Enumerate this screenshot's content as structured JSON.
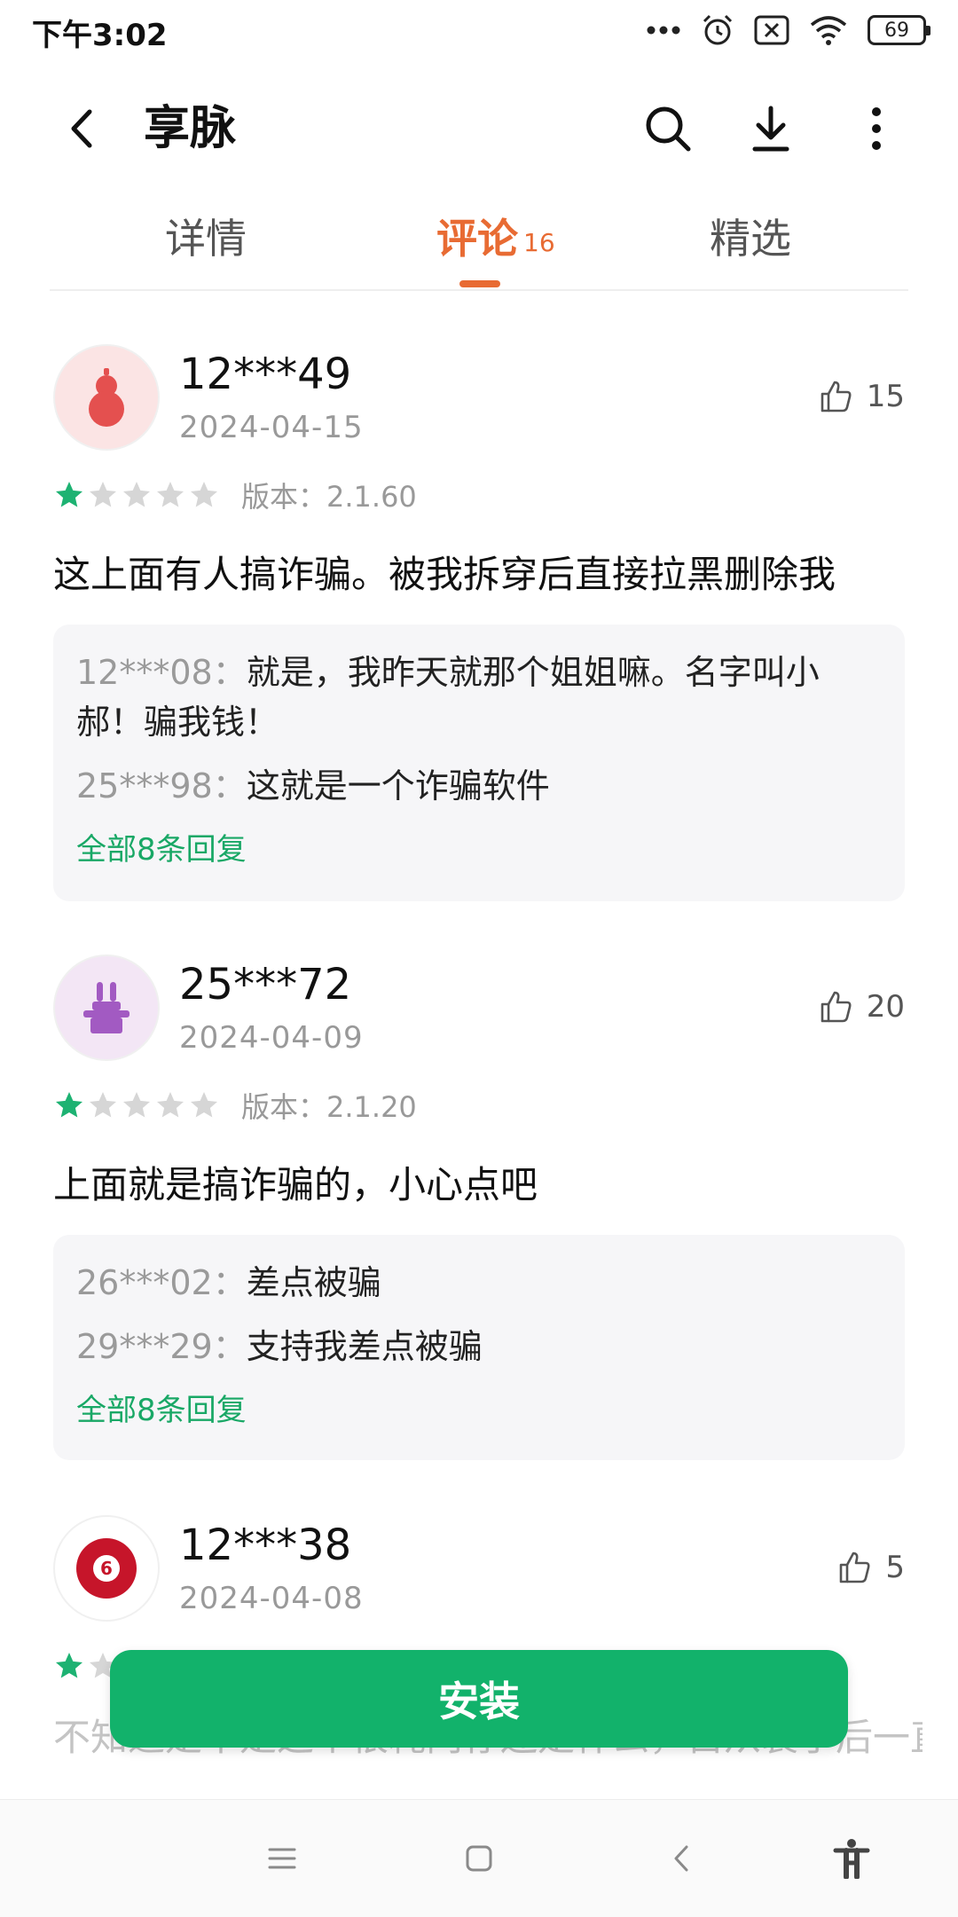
{
  "status_bar": {
    "time": "下午3:02",
    "battery": "69",
    "icons": [
      "dots-icon",
      "alarm-icon",
      "sim-off-icon",
      "wifi-icon",
      "battery-icon"
    ]
  },
  "app_bar": {
    "title": "享脉",
    "actions": [
      "back-icon",
      "search-icon",
      "download-icon",
      "more-vertical-icon"
    ]
  },
  "tabs": [
    {
      "label": "详情"
    },
    {
      "label": "评论",
      "count": "16",
      "active": true
    },
    {
      "label": "精选"
    }
  ],
  "reviews": [
    {
      "username": "12***49",
      "date": "2024-04-15",
      "likes": "15",
      "rating": 1,
      "version": "版本：2.1.60",
      "text": "这上面有人搞诈骗。被我拆穿后直接拉黑删除我",
      "avatar_icon": "gourd-icon",
      "replies": [
        {
          "name": "12***08：",
          "text": "就是，我昨天就那个姐姐嘛。名字叫小郝！骗我钱！"
        },
        {
          "name": "25***98：",
          "text": "这就是一个诈骗软件"
        }
      ],
      "all_replies": "全部8条回复"
    },
    {
      "username": "25***72",
      "date": "2024-04-09",
      "likes": "20",
      "rating": 1,
      "version": "版本：2.1.20",
      "text": "上面就是搞诈骗的，小心点吧",
      "avatar_icon": "magic-hat-rabbit-icon",
      "replies": [
        {
          "name": "26***02：",
          "text": "差点被骗"
        },
        {
          "name": "29***29：",
          "text": "支持我差点被骗"
        }
      ],
      "all_replies": "全部8条回复"
    },
    {
      "username": "12***38",
      "date": "2024-04-08",
      "likes": "5",
      "rating": 1,
      "text": "不知道是不是这个很耗内存还是什么，自从装了后一直在后台运行，即使清理了也消息还能收",
      "avatar_icon": "billiard-ball-6-icon",
      "avatar_label": "6"
    }
  ],
  "install_button": "安装",
  "nav_bar": [
    "menu-icon",
    "home-icon",
    "back-nav-icon",
    "accessibility-icon"
  ],
  "colors": {
    "accent_orange": "#e86b33",
    "install_green": "#12b26b",
    "link_green": "#19a866",
    "star_green": "#1db272",
    "star_grey": "#d6d6d6"
  }
}
